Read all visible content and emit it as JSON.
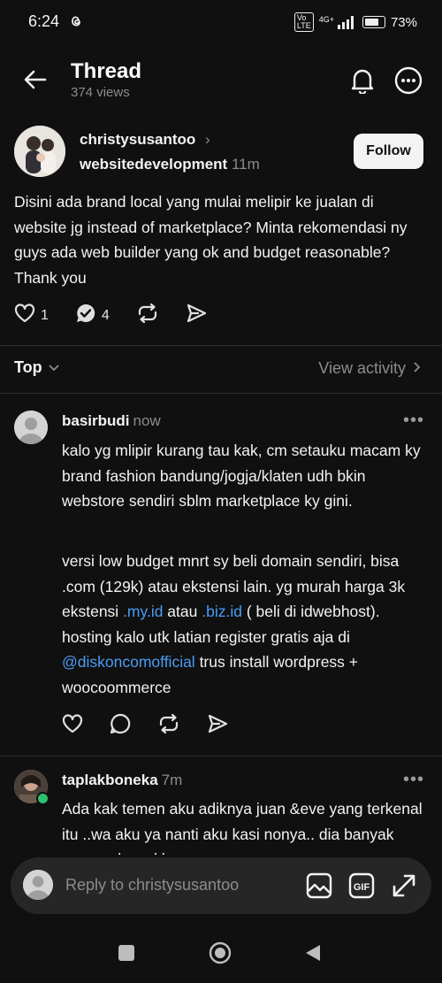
{
  "status": {
    "time": "6:24",
    "battery": "73%",
    "network": "4G+"
  },
  "header": {
    "title": "Thread",
    "views": "374 views"
  },
  "post": {
    "author": "christysusantoo",
    "community": "websitedevelopment",
    "time": "11m",
    "follow_label": "Follow",
    "text": "Disini ada brand local yang mulai melipir ke jualan di website jg instead of marketplace? Minta rekomendasi ny guys ada web builder yang ok and budget reasonable? Thank you",
    "likes": "1",
    "replies": "4"
  },
  "sort": {
    "label": "Top",
    "view_activity": "View activity"
  },
  "replies": [
    {
      "author": "basirbudi",
      "time": "now",
      "para1": "kalo yg mlipir kurang tau kak, cm setauku macam ky brand fashion bandung/jogja/klaten udh bkin webstore sendiri sblm marketplace ky gini.",
      "p2_a": "versi low budget mnrt sy beli domain sendiri, bisa .com (129k) atau ekstensi lain. yg murah harga 3k  ekstensi ",
      "p2_link1": ".my.id",
      "p2_b": " atau ",
      "p2_link2": ".biz.id",
      "p2_c": " ( beli di idwebhost). hosting kalo utk latian register gratis aja di ",
      "p2_link3": "@diskoncomofficial",
      "p2_d": " trus install wordpress + woocoommerce"
    },
    {
      "author": "taplakboneka",
      "time": "7m",
      "text": "Ada kak temen aku adiknya juan &eve yang terkenal itu ..wa aku ya nanti aku kasi nonya.. dia banyak pegang brand besar"
    }
  ],
  "composer": {
    "placeholder": "Reply to christysusantoo"
  },
  "icons": [
    "back-arrow-icon",
    "bell-icon",
    "more-icon",
    "heart-icon",
    "comment-icon",
    "repost-icon",
    "share-icon",
    "image-icon",
    "gif-icon",
    "expand-icon"
  ]
}
